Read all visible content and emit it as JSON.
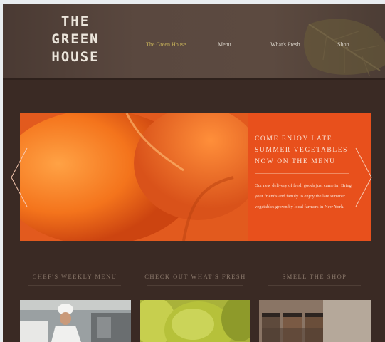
{
  "brand": {
    "logo_lines": [
      "THE",
      "GREEN",
      "HOUSE"
    ]
  },
  "nav": {
    "items": [
      "The Green House",
      "Menu",
      "What's Fresh",
      "Shop"
    ],
    "active_color": "#c8b35a"
  },
  "hero": {
    "title_lines": [
      "COME ENJOY LATE",
      "SUMMER VEGETABLES",
      "NOW ON THE MENU"
    ],
    "body": "Our new delivery of fresh goods just came in! Bring your friends and family to enjoy the late summer vegetables grown by local farmers in New York.",
    "accent_color": "#e8501c"
  },
  "sections": [
    "CHEF'S WEEKLY MENU",
    "CHECK OUT WHAT'S FRESH",
    "SMELL THE SHOP"
  ],
  "icons": {
    "prev": "chevron-left-icon",
    "next": "chevron-right-icon",
    "leaf": "leaf-icon"
  },
  "colors": {
    "background": "#3a2a24",
    "header": "#5a483f",
    "heading_text": "#8a786b"
  }
}
